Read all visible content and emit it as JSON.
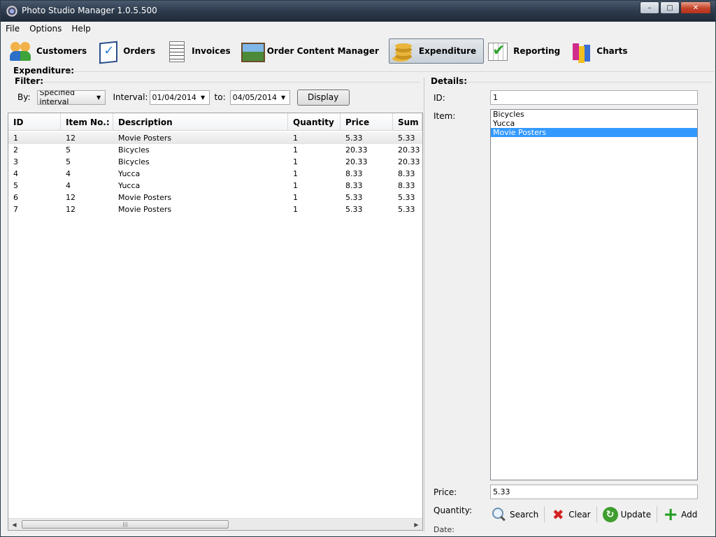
{
  "window": {
    "title": "Photo Studio Manager 1.0.5.500",
    "minimize": "–",
    "maximize": "□",
    "close": "✕"
  },
  "menu": [
    "File",
    "Options",
    "Help"
  ],
  "toolbar": [
    {
      "label": "Customers",
      "icon": "customers-icon",
      "active": false
    },
    {
      "label": "Orders",
      "icon": "orders-icon",
      "active": false
    },
    {
      "label": "Invoices",
      "icon": "invoices-icon",
      "active": false
    },
    {
      "label": "Order Content Manager",
      "icon": "content-manager-icon",
      "active": false
    },
    {
      "label": "Expenditure",
      "icon": "coins-icon",
      "active": true
    },
    {
      "label": "Reporting",
      "icon": "reporting-icon",
      "active": false
    },
    {
      "label": "Charts",
      "icon": "charts-icon",
      "active": false
    }
  ],
  "page": {
    "heading": "Expenditure:",
    "filter_heading": "Filter:",
    "details_heading": "Details:"
  },
  "filter": {
    "by_label": "By:",
    "by_value": "Specified interval",
    "interval_label": "Interval:",
    "from_date": "01/04/2014",
    "to_label": "to:",
    "to_date": "04/05/2014",
    "display_button": "Display"
  },
  "grid": {
    "columns": [
      "ID",
      "Item No.:",
      "Description",
      "Quantity",
      "Price",
      "Sum T"
    ],
    "rows": [
      [
        "1",
        "12",
        "Movie Posters",
        "1",
        "5.33",
        "5.33"
      ],
      [
        "2",
        "5",
        "Bicycles",
        "1",
        "20.33",
        "20.33"
      ],
      [
        "3",
        "5",
        "Bicycles",
        "1",
        "20.33",
        "20.33"
      ],
      [
        "4",
        "4",
        "Yucca",
        "1",
        "8.33",
        "8.33"
      ],
      [
        "5",
        "4",
        "Yucca",
        "1",
        "8.33",
        "8.33"
      ],
      [
        "6",
        "12",
        "Movie Posters",
        "1",
        "5.33",
        "5.33"
      ],
      [
        "7",
        "12",
        "Movie Posters",
        "1",
        "5.33",
        "5.33"
      ]
    ],
    "selected_row": 0
  },
  "details": {
    "id_label": "ID:",
    "id_value": "1",
    "item_label": "Item:",
    "items": [
      "Bicycles",
      "Yucca",
      "Movie Posters"
    ],
    "selected_item": 2,
    "price_label": "Price:",
    "price_value": "5.33",
    "quantity_label": "Quantity:",
    "date_label": "Date:"
  },
  "actions": [
    {
      "label": "Search",
      "icon": "search-icon"
    },
    {
      "label": "Clear",
      "icon": "clear-icon"
    },
    {
      "label": "Update",
      "icon": "update-icon"
    },
    {
      "label": "Add",
      "icon": "add-icon"
    }
  ],
  "colors": {
    "selection": "#3399ff",
    "titlebar": "#2f3d4f"
  }
}
